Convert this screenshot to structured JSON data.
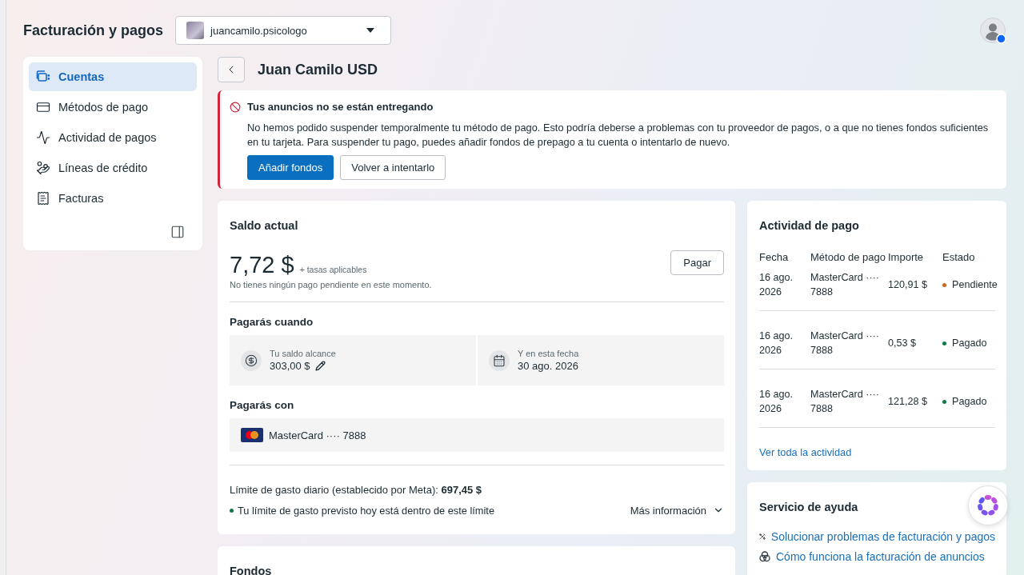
{
  "header": {
    "title": "Facturación y pagos",
    "account_selector": {
      "value": "juancamilo.psicologo"
    }
  },
  "sidebar": {
    "items": [
      {
        "label": "Cuentas",
        "selected": true
      },
      {
        "label": "Métodos de pago",
        "selected": false
      },
      {
        "label": "Actividad de pagos",
        "selected": false
      },
      {
        "label": "Líneas de crédito",
        "selected": false
      },
      {
        "label": "Facturas",
        "selected": false
      }
    ]
  },
  "page": {
    "title": "Juan Camilo USD"
  },
  "alert": {
    "title": "Tus anuncios no se están entregando",
    "body": "No hemos podido suspender temporalmente tu método de pago. Esto podría deberse a problemas con tu proveedor de pagos, o a que no tienes fondos suficientes en tu tarjeta. Para suspender tu pago, puedes añadir fondos de prepago a tu cuenta o intentarlo de nuevo.",
    "buttons": [
      {
        "label": "Añadir fondos",
        "kind": "primary"
      },
      {
        "label": "Volver a intentarlo",
        "kind": "secondary"
      }
    ]
  },
  "balance": {
    "title": "Saldo actual",
    "amount": "7,72 $",
    "fees_note": "+ tasas aplicables",
    "pending_note": "No tienes ningún pago pendiente en este momento.",
    "pay_button": "Pagar",
    "pay_when": {
      "heading": "Pagarás cuando",
      "items": [
        {
          "label": "Tu saldo alcance",
          "value": "303,00 $",
          "editable": true
        },
        {
          "label": "Y en esta fecha",
          "value": "30 ago. 2026",
          "editable": false
        }
      ]
    },
    "pay_with": {
      "heading": "Pagarás con",
      "method": "MasterCard ···· 7888"
    },
    "limit": "Límite de gasto diario (establecido por Meta): **697,45 $**",
    "limit_status": "Tu límite de gasto previsto hoy está dentro de este límite",
    "more_info": "Más información"
  },
  "funds": {
    "title": "Fondos"
  },
  "activity": {
    "title": "Actividad de pago",
    "columns": [
      "Fecha",
      "Método de pago",
      "Importe",
      "Estado"
    ],
    "rows": [
      {
        "date": "16 ago. 2026",
        "method": "MasterCard ···· 7888",
        "amount": "120,91 $",
        "status": "Pendiente",
        "color": "#c7661d"
      },
      {
        "date": "16 ago. 2026",
        "method": "MasterCard ···· 7888",
        "amount": "0,53 $",
        "status": "Pagado",
        "color": "#0e7a45"
      },
      {
        "date": "16 ago. 2026",
        "method": "MasterCard ···· 7888",
        "amount": "121,28 $",
        "status": "Pagado",
        "color": "#0e7a45"
      }
    ],
    "link": "Ver toda la actividad"
  },
  "help": {
    "title": "Servicio de ayuda",
    "links": [
      "Solucionar problemas de facturación y pagos",
      "Cómo funciona la facturación de anuncios"
    ]
  }
}
